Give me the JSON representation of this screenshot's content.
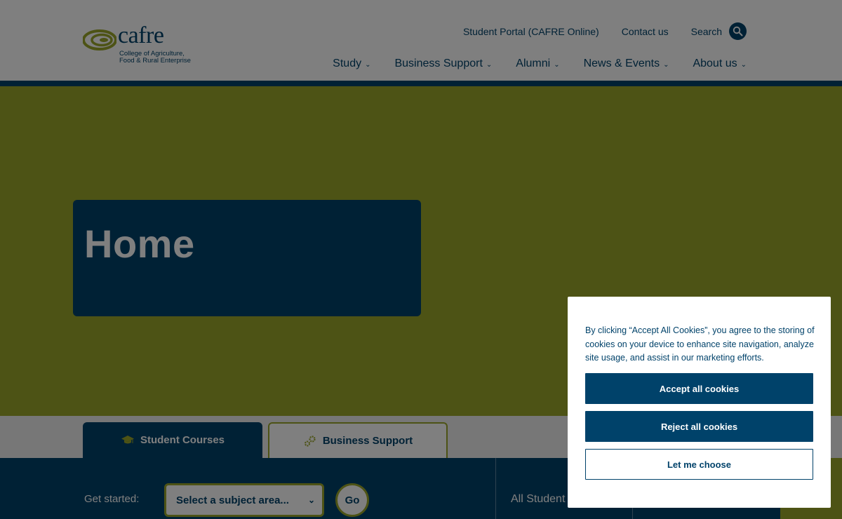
{
  "header": {
    "logo": {
      "word": "cafre",
      "sub_line1": "College of Agriculture,",
      "sub_line2": "Food & Rural Enterprise"
    },
    "utility_links": {
      "portal": "Student Portal (CAFRE Online)",
      "contact": "Contact us",
      "search": "Search"
    },
    "nav": {
      "study": "Study",
      "business_support": "Business Support",
      "alumni": "Alumni",
      "news_events": "News & Events",
      "about_us": "About us"
    }
  },
  "hero": {
    "title": "Home"
  },
  "tabs": {
    "student_courses": "Student Courses",
    "business_support": "Business Support"
  },
  "finder": {
    "label": "Get started:",
    "select_value": "Select a subject area...",
    "go_label": "Go",
    "all_student": "All Student"
  },
  "cookie_banner": {
    "text": "By clicking “Accept All Cookies”, you agree to the storing of cookies on your device to enhance site navigation, analyze site usage, and assist in our marketing efforts.",
    "accept_label": "Accept all cookies",
    "reject_label": "Reject all cookies",
    "choose_label": "Let me choose"
  },
  "colors": {
    "brand_navy": "#00426a",
    "brand_green": "#9aa62a",
    "overlay": "rgba(0,0,0,0.5)"
  },
  "icons": {
    "search": "search-icon",
    "chevron": "chevron-down-icon",
    "graduation": "graduation-cap-icon",
    "gears": "gears-icon",
    "logo_mark": "swirl-logo-icon"
  }
}
